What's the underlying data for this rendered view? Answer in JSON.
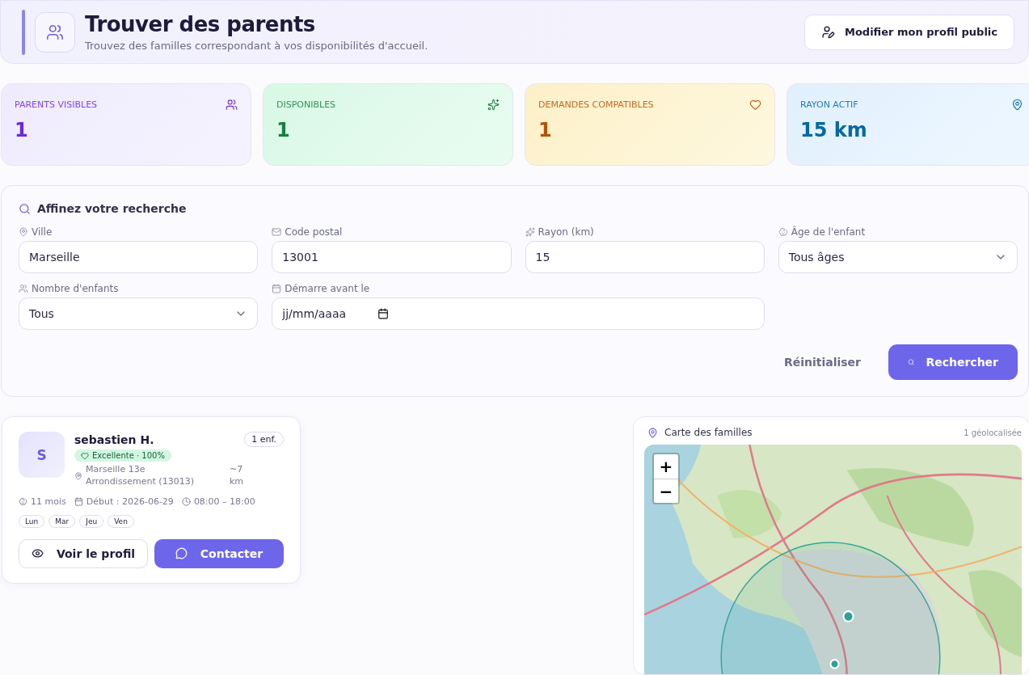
{
  "header": {
    "title": "Trouver des parents",
    "subtitle": "Trouvez des familles correspondant à vos disponibilités d'accueil.",
    "edit_button": "Modifier mon profil public"
  },
  "stats": [
    {
      "kind": "users",
      "label": "PARENTS VISIBLES",
      "value": "1",
      "color": "#6d28d9"
    },
    {
      "kind": "sparkles",
      "label": "DISPONIBLES",
      "value": "1",
      "color": "#15803d"
    },
    {
      "kind": "heart",
      "label": "DEMANDES COMPATIBLES",
      "value": "1",
      "color": "#b45309"
    },
    {
      "kind": "pin",
      "label": "RAYON ACTIF",
      "value": "15 km",
      "color": "#0369a1"
    }
  ],
  "filters": {
    "title": "Affinez votre recherche",
    "fields": [
      {
        "kind": "text",
        "label": "Ville",
        "value": "Marseille"
      },
      {
        "kind": "text",
        "label": "Code postal",
        "value": "13001"
      },
      {
        "kind": "text",
        "label": "Rayon (km)",
        "value": "15"
      },
      {
        "kind": "select",
        "label": "Âge de l'enfant",
        "value": "Tous âges"
      },
      {
        "kind": "select",
        "label": "Nombre d'enfants",
        "value": "Tous"
      },
      {
        "kind": "date",
        "label": "Démarre avant le",
        "placeholder": "jj/mm/aaaa"
      }
    ],
    "reset_button": "Réinitialiser",
    "search_button": "Rechercher"
  },
  "results": [
    {
      "initial": "S",
      "name": "sebastien H.",
      "children": "1 enf.",
      "match": "Excellente · 100%",
      "location": "Marseille 13e Arrondissement (13013)",
      "distance": "~7 km",
      "age": "11 mois",
      "start": "Début : 2026-06-29",
      "hours": "08:00 – 18:00",
      "days": [
        "Lun",
        "Mar",
        "Jeu",
        "Ven"
      ],
      "profile_button": "Voir le profil",
      "contact_button": "Contacter"
    }
  ],
  "map": {
    "title": "Carte des familles",
    "count": "1 géolocalisée",
    "zoom_in": "+",
    "zoom_out": "−"
  }
}
